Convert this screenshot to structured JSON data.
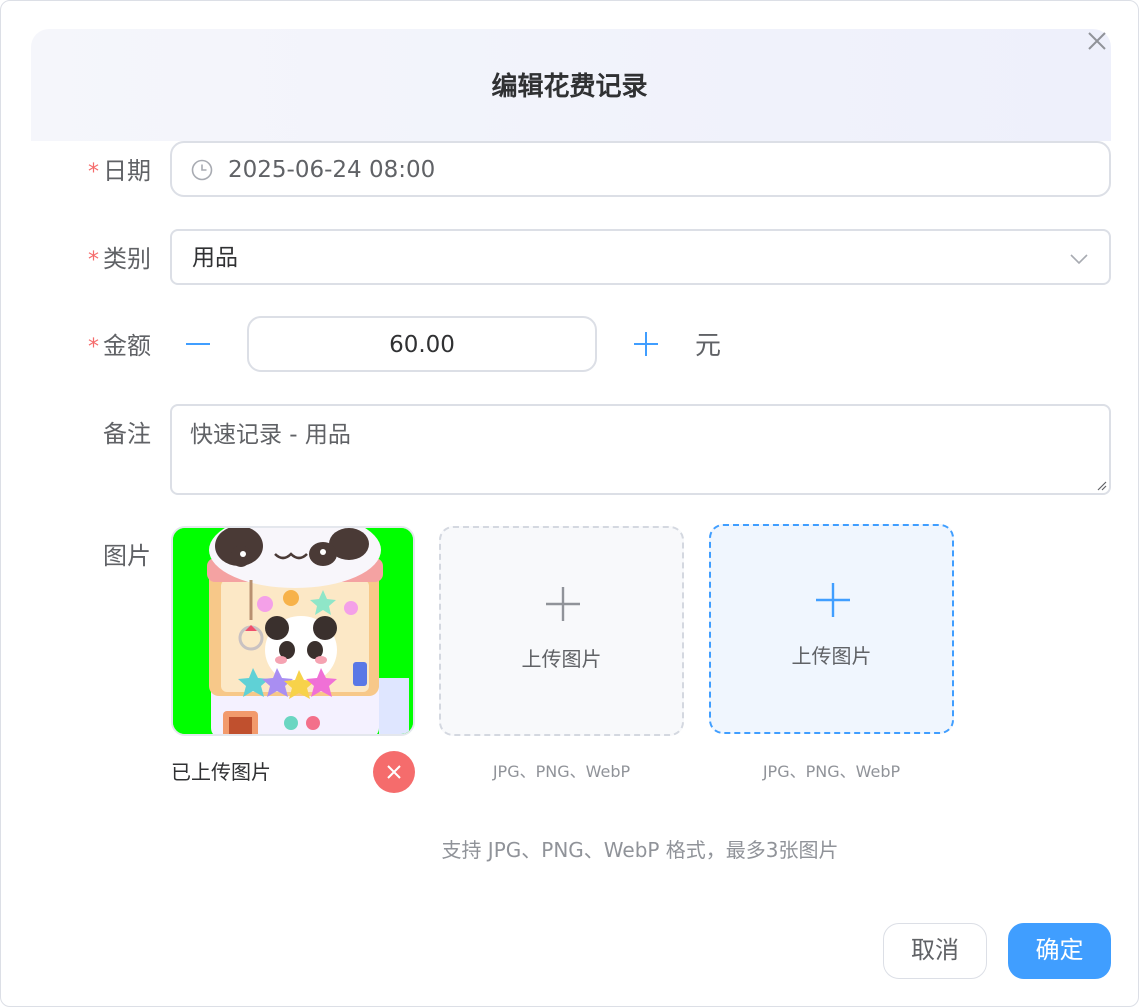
{
  "dialog": {
    "title": "编辑花费记录"
  },
  "form": {
    "date": {
      "label": "日期",
      "required_mark": "*",
      "value": "2025-06-24 08:00"
    },
    "category": {
      "label": "类别",
      "required_mark": "*",
      "value": "用品"
    },
    "amount": {
      "label": "金额",
      "required_mark": "*",
      "value": "60.00",
      "unit": "元"
    },
    "note": {
      "label": "备注",
      "value": "快速记录 - 用品"
    },
    "images": {
      "label": "图片",
      "uploaded_caption": "已上传图片",
      "upload_slots": [
        {
          "text": "上传图片",
          "formats": "JPG、PNG、WebP"
        },
        {
          "text": "上传图片",
          "formats": "JPG、PNG、WebP"
        }
      ],
      "hint": "支持 JPG、PNG、WebP 格式，最多3张图片"
    }
  },
  "footer": {
    "cancel_label": "取消",
    "confirm_label": "确定"
  },
  "colors": {
    "accent": "#409eff",
    "danger": "#f56c6c",
    "image_background": "#00ff00"
  },
  "icons": {
    "close": "close-icon",
    "clock": "clock-icon",
    "dropdown": "chevron-down-icon",
    "minus": "minus-icon",
    "plus": "plus-icon",
    "remove": "close-icon",
    "upload": "plus-icon"
  }
}
